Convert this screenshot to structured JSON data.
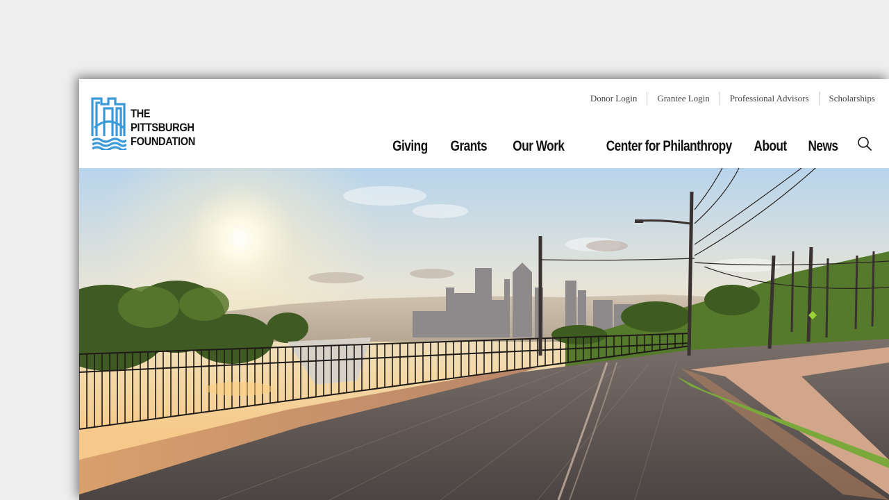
{
  "brand": {
    "logo_line1": "THE",
    "logo_line2": "PITTSBURGH",
    "logo_line3": "FOUNDATION",
    "logo_color": "#3a9ad9"
  },
  "utility_nav": [
    {
      "label": "Donor Login"
    },
    {
      "label": "Grantee Login"
    },
    {
      "label": "Professional Advisors"
    },
    {
      "label": "Scholarships"
    }
  ],
  "main_nav": [
    {
      "label": "Giving"
    },
    {
      "label": "Grants"
    },
    {
      "label": "Our Work"
    },
    {
      "label": "Center for Philanthropy"
    },
    {
      "label": "About"
    },
    {
      "label": "News"
    }
  ],
  "icons": {
    "search": "search-icon"
  }
}
